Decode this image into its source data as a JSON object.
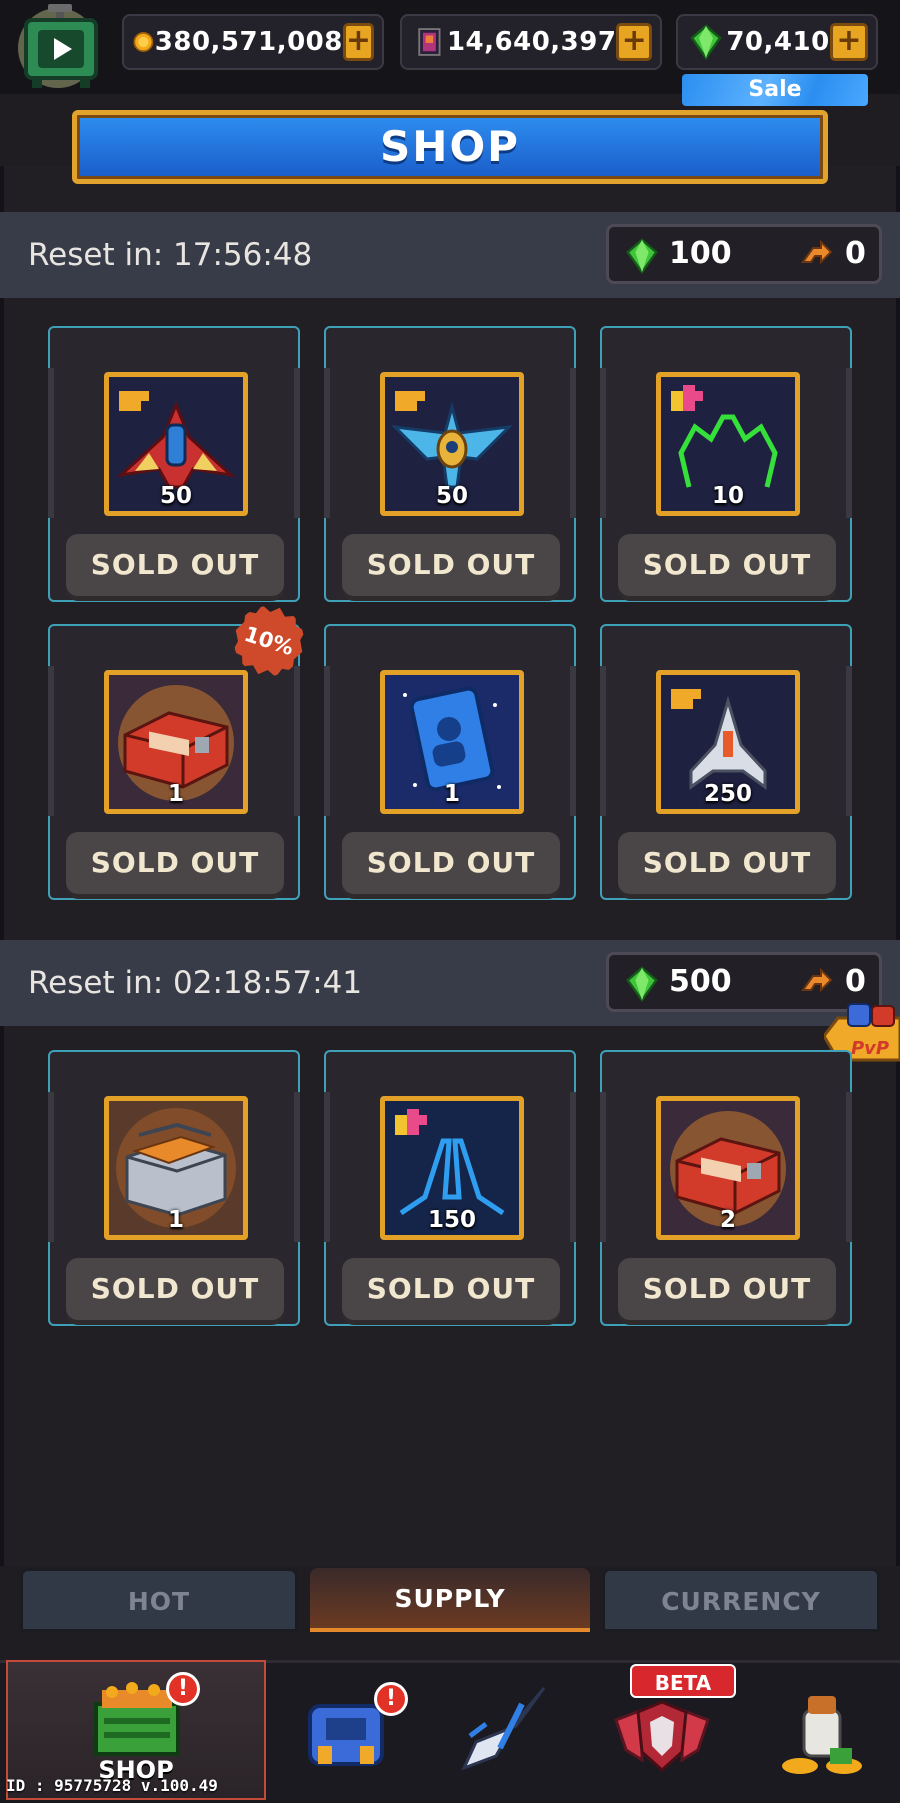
{
  "header": {
    "coins": "380,571,008",
    "tickets": "14,640,397",
    "gems": "70,410",
    "gems_sale_label": "Sale"
  },
  "banner": {
    "title": "SHOP"
  },
  "sections": [
    {
      "reset_label": "Reset in: 17:56:48",
      "cost": {
        "gems": "100",
        "tickets": "0"
      },
      "items": [
        {
          "name": "fighter-ship-shard",
          "qty": "50",
          "button": "SOLD OUT"
        },
        {
          "name": "bird-ship-shard",
          "qty": "50",
          "button": "SOLD OUT"
        },
        {
          "name": "green-wing-shard",
          "qty": "10",
          "button": "SOLD OUT"
        },
        {
          "name": "red-chest",
          "qty": "1",
          "button": "SOLD OUT",
          "discount": "10%"
        },
        {
          "name": "blue-card",
          "qty": "1",
          "button": "SOLD OUT"
        },
        {
          "name": "white-ship-shard",
          "qty": "250",
          "button": "SOLD OUT"
        }
      ]
    },
    {
      "reset_label": "Reset in: 02:18:57:41",
      "cost": {
        "gems": "500",
        "tickets": "0"
      },
      "items": [
        {
          "name": "supply-crate",
          "qty": "1",
          "button": "SOLD OUT"
        },
        {
          "name": "blue-wing-shard",
          "qty": "150",
          "button": "SOLD OUT"
        },
        {
          "name": "red-chest",
          "qty": "2",
          "button": "SOLD OUT"
        }
      ]
    }
  ],
  "pvp_badge": "PvP",
  "tabs": [
    {
      "label": "HOT",
      "active": false
    },
    {
      "label": "SUPPLY",
      "active": true
    },
    {
      "label": "CURRENCY",
      "active": false
    }
  ],
  "nav": {
    "shop_label": "SHOP",
    "alert": "!",
    "beta_label": "BETA"
  },
  "footer": {
    "version": "ID : 95775728 v.100.49"
  },
  "colors": {
    "accent_gold": "#e4a128",
    "card_border": "#3fa1b8",
    "banner_blue": "#2e8ef0",
    "gem_green": "#3fc43a"
  }
}
